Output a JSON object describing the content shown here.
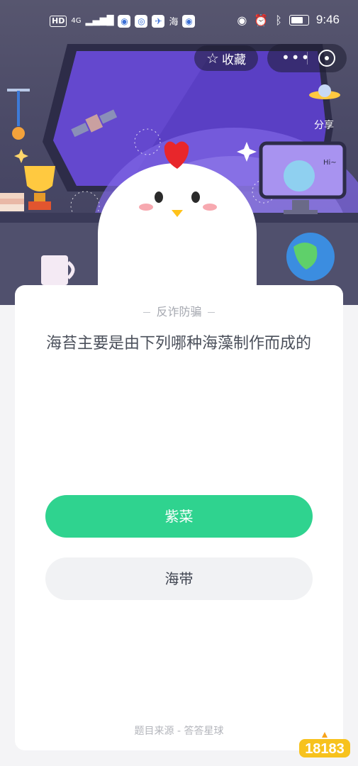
{
  "status_bar": {
    "network_badge": "HD",
    "signal_label": "4G",
    "app_icon_label": "海",
    "time": "9:46"
  },
  "header": {
    "favorite_label": "收藏",
    "share_label": "分享",
    "planet_tag": "Hi~"
  },
  "quiz": {
    "category": "反诈防骗",
    "question": "海苔主要是由下列哪种海藻制作而成的",
    "options": [
      {
        "label": "紫菜",
        "state": "highlighted"
      },
      {
        "label": "海带",
        "state": "normal"
      }
    ],
    "source": "题目来源 - 答答星球"
  },
  "watermark": {
    "text": "18183"
  },
  "colors": {
    "accent_green": "#2fd38f",
    "option_gray": "#f1f2f4",
    "scene_bg": "#4b4a67"
  }
}
